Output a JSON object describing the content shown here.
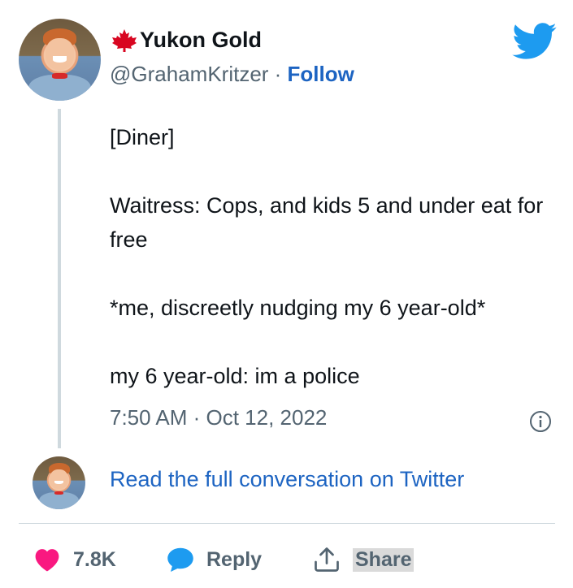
{
  "author": {
    "display_name": "Yukon Gold",
    "handle": "@GrahamKritzer",
    "separator": " · ",
    "follow_label": "Follow"
  },
  "tweet": {
    "lines": [
      "[Diner]",
      "Waitress: Cops, and kids 5 and under eat for free",
      "*me, discreetly nudging my 6 year-old*",
      "my 6 year-old: im a police"
    ],
    "timestamp": "7:50 AM · Oct 12, 2022"
  },
  "conversation": {
    "read_full_label": "Read the full conversation on Twitter"
  },
  "actions": {
    "like_count": "7.8K",
    "reply_label": "Reply",
    "share_label": "Share"
  },
  "colors": {
    "link": "#1d64c2",
    "twitter_blue": "#1d9bf0",
    "like_pink": "#f91880",
    "muted": "#536471"
  },
  "icons": [
    "maple-leaf-icon",
    "twitter-bird-icon",
    "info-icon",
    "heart-icon",
    "reply-bubble-icon",
    "share-icon"
  ]
}
